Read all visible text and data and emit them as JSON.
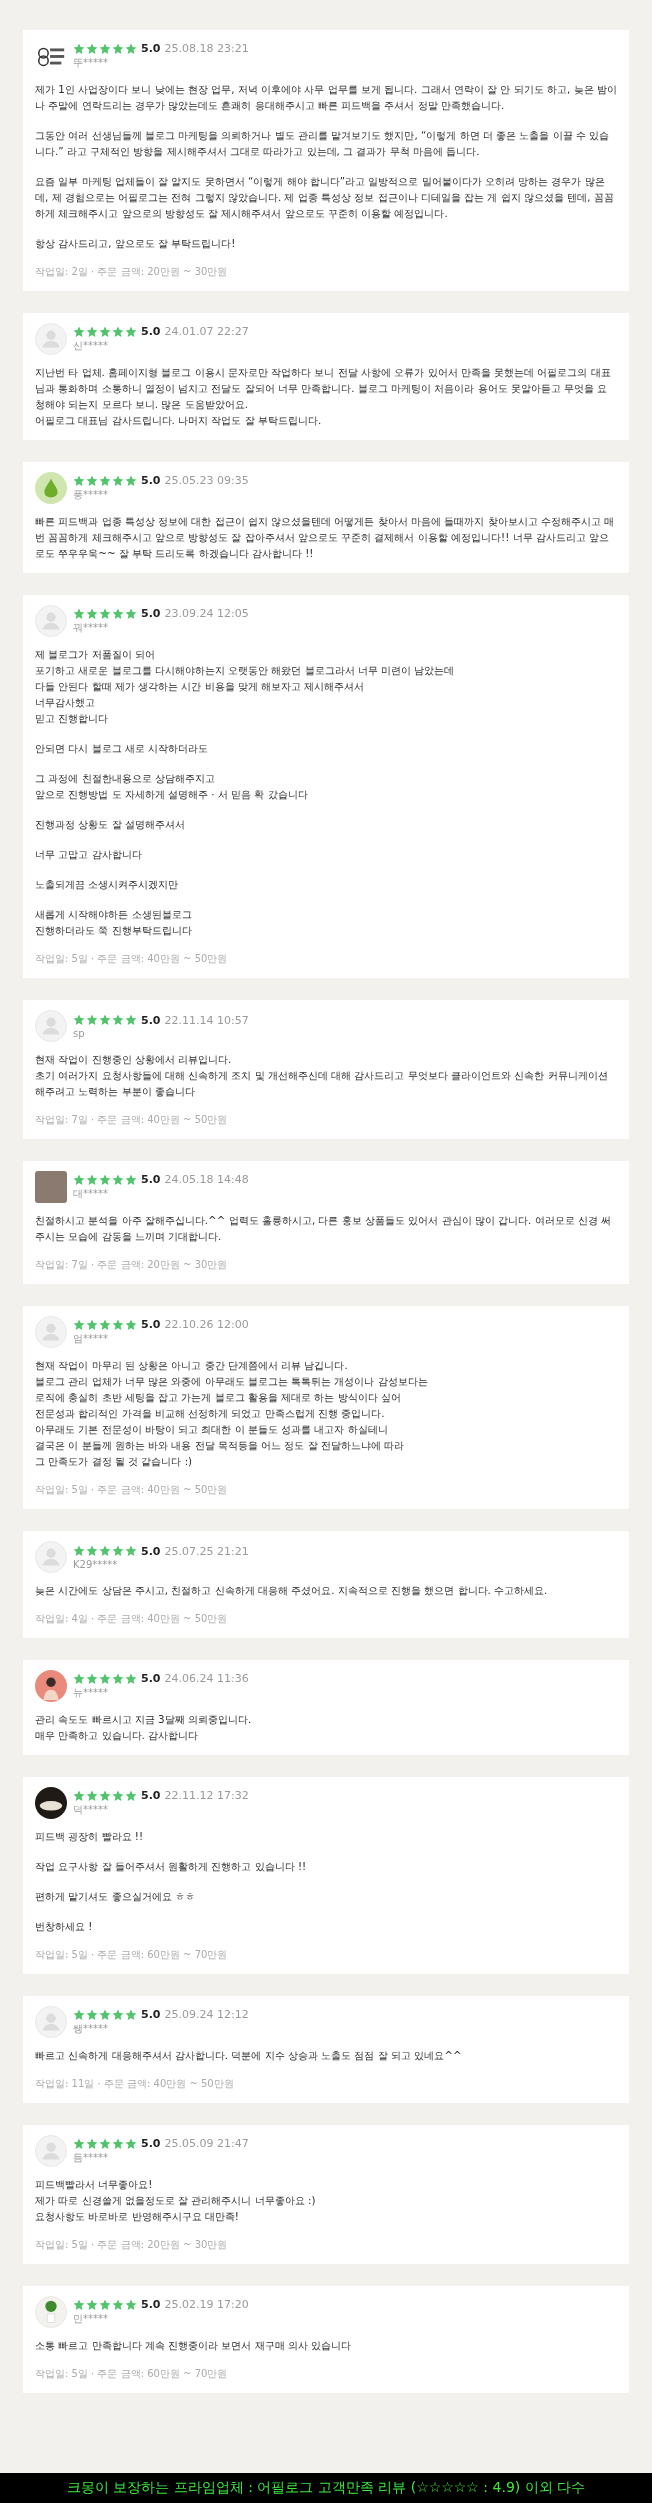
{
  "reviews": [
    {
      "avatar": {
        "kind": "logo"
      },
      "stars": 5,
      "rating": "5.0",
      "date": "25.08.18 23:21",
      "user": "뚜*****",
      "paragraphs": [
        "제가 1인 사업장이다 보니 낮에는 현장 업무, 저녁 이후에야 사무 업무를 보게 됩니다. 그래서 연락이 잘 안 되기도 하고, 늦은 밤이나 주말에 연락드리는 경우가 많았는데도 흔쾌히 응대해주시고 빠른 피드백을 주셔서 정말 만족했습니다.",
        "그동안 여러 선생님들께 블로그 마케팅을 의뢰하거나 별도 관리를 맡겨보기도 했지만, “이렇게 하면 더 좋은 노출을 이끌 수 있습니다.” 라고 구체적인 방향을 제시해주셔서 그대로 따라가고 있는데, 그 결과가 무척 마음에 듭니다.",
        "요즘 일부 마케팅 업체들이 잘 알지도 못하면서 “이렇게 해야 합니다”라고 일방적으로 밀어붙이다가 오히려 망하는 경우가 많은데, 제 경험으로는 어필로그는 전혀 그렇지 않았습니다. 제 업종 특성상 정보 접근이나 디테일을 잡는 게 쉽지 않으셨을 텐데, 꼼꼼하게 체크해주시고 앞으로의 방향성도 잘 제시해주셔서 앞으로도 꾸준히 이용할 예정입니다.",
        "항상 감사드리고, 앞으로도 잘 부탁드립니다!"
      ],
      "meta": "작업일: 2일 · 주문 금액: 20만원 ~ 30만원"
    },
    {
      "avatar": {
        "kind": "default"
      },
      "stars": 5,
      "rating": "5.0",
      "date": "24.01.07 22:27",
      "user": "신*****",
      "paragraphs": [
        "지난번 타 업체. 홈페이지형 블로그 이용시 문자로만 작업하다 보니 전달 사항에 오류가 있어서 만족을 못했는데 어필로그의  대표님과 통화하며 소통하니 열정이 넘치고 전달도 잘되어 너무 만족합니다. 블로그 마케팅이 처음이라 용어도 못알아듣고 무엇을 요청해야 되는지 모르다 보니. 많은 도움받았어요.\n어필로그 대표님 감사드립니다. 나머지 작업도 잘 부탁드립니다."
      ]
    },
    {
      "avatar": {
        "kind": "pear"
      },
      "stars": 5,
      "rating": "5.0",
      "date": "25.05.23 09:35",
      "user": "풍*****",
      "paragraphs": [
        "빠른 피드백과 업종 특성상 정보에 대한 접근이 쉽지 않으셨을텐데 어떻게든 찾아서 마음에 들때까지 찾아보시고 수정해주시고 매번 꼼꼼하게 체크해주시고 앞으로 방향성도 잘 잡아주셔서 앞으로도 꾸준히 결제해서 이용할 예정입니다!! 너무 감사드리고 앞으로도 쭈우우욱~~ 잘 부탁 드리도록 하겠습니다 감사합니다 !!"
      ]
    },
    {
      "avatar": {
        "kind": "default"
      },
      "stars": 5,
      "rating": "5.0",
      "date": "23.09.24 12:05",
      "user": "꿔*****",
      "paragraphs": [
        "제 블로그가 저품질이 되어\n포기하고 새로운 블로그를 다시해야하는지  오랫동안 해왔던 블로그라서 너무 미련이 남았는데\n다들 안된다 할때  제가 생각하는 시간 비용을  맞게  해보자고 제시해주셔서\n너무감사했고\n믿고  진행합니다",
        "안되면  다시 블로그 새로 시작하더라도",
        "그 과정에 친절한내용으로 상담해주지고\n앞으로 진행방법 도 자세하게 설명해주 · 서 믿음 확 갔습니다",
        "진행과정 상황도 잘 설명해주셔서",
        "너무 고맙고 감사합니다",
        "노출되게끔 소생시켜주시겠지만",
        "새롭게 시작해야하든  소생된블로그\n진행하더라도  쭉 진행부탁드립니다"
      ],
      "meta": "작업일: 5일 · 주문 금액: 40만원 ~ 50만원"
    },
    {
      "avatar": {
        "kind": "default"
      },
      "stars": 5,
      "rating": "5.0",
      "date": "22.11.14 10:57",
      "user": "sp",
      "paragraphs": [
        "현재 작업이 진행중인 상황에서  리뷰입니다.\n초기 여러가지 요청사항들에 대해 신속하게 조치 및 개선해주신데 대해 감사드리고 무엇보다 클라이언트와 신속한 커뮤니케이션 해주려고 노력하는 부분이 좋습니다"
      ],
      "meta": "작업일: 7일 · 주문 금액: 40만원 ~ 50만원"
    },
    {
      "avatar": {
        "kind": "photo"
      },
      "stars": 5,
      "rating": "5.0",
      "date": "24.05.18 14:48",
      "user": "대*****",
      "paragraphs": [
        "친절하시고 분석을 아주 잘해주십니다.^^ 업력도 훌륭하시고, 다른 홍보 상품들도 있어서 관심이 많이 갑니다. 여러모로 신경 써주시는 모습에 감동을 느끼며 기대합니다."
      ],
      "meta": "작업일: 7일 · 주문 금액: 20만원 ~ 30만원"
    },
    {
      "avatar": {
        "kind": "default"
      },
      "stars": 5,
      "rating": "5.0",
      "date": "22.10.26 12:00",
      "user": "엄*****",
      "paragraphs": [
        "현재 작업이 마무리 된 상황은 아니고 중간 단계쯤에서 리뷰 남깁니다.\n블로그 관리 업체가 너무 많은 와중에 아무래도 블로그는 톡톡튀는 개성이나 감성보다는\n로직에 충실히 초반 세팅을 잡고 가는게 블로그 활용을 제대로 하는 방식이다 싶어\n전문성과 합리적인 가격을 비교해 선정하게 되었고 만족스럽게 진행 중입니다.\n아무래도 기본 전문성이 바탕이 되고 최대한 이 분들도 성과를 내고자 하실테니\n결국은 이 분들께 원하는 바와 내용 전달 목적등을 어느 정도 잘 전달하느냐에 따라\n그 만족도가 결정 될 것 같습니다 :)"
      ],
      "meta": "작업일: 5일 · 주문 금액: 40만원 ~ 50만원"
    },
    {
      "avatar": {
        "kind": "default"
      },
      "stars": 5,
      "rating": "5.0",
      "date": "25.07.25 21:21",
      "user": "K29*****",
      "paragraphs": [
        "늦은 시간에도 상담은 주시고, 친절하고 신속하게 대응해 주셨어요. 지속적으로 진행을 했으면 합니다. 수고하세요."
      ],
      "meta": "작업일: 4일 · 주문 금액: 40만원 ~ 50만원"
    },
    {
      "avatar": {
        "kind": "portrait"
      },
      "stars": 5,
      "rating": "5.0",
      "date": "24.06.24 11:36",
      "user": "뉴*****",
      "paragraphs": [
        "관리 속도도 빠르시고 지금 3달째 의뢰중입니다.\n매우 만족하고 있습니다. 감사합니다"
      ]
    },
    {
      "avatar": {
        "kind": "dark"
      },
      "stars": 5,
      "rating": "5.0",
      "date": "22.11.12 17:32",
      "user": "덕*****",
      "paragraphs": [
        "피드백 굉장히 빨라요 !!",
        "작업 요구사항 잘 들어주셔서 원활하게 진행하고 있습니다 !!",
        "편하게 맡기셔도 좋으실거에요 ㅎㅎ",
        "번창하세요 !"
      ],
      "meta": "작업일: 5일 · 주문 금액: 60만원 ~ 70만원"
    },
    {
      "avatar": {
        "kind": "default"
      },
      "stars": 5,
      "rating": "5.0",
      "date": "25.09.24 12:12",
      "user": "쌩*****",
      "paragraphs": [
        "빠르고 신속하게 대응해주셔서 감사합니다.  덕분에 지수 상승과 노출도 점점 잘 되고 있네요^^"
      ],
      "meta": "작업일: 11일 · 주문 금액: 40만원 ~ 50만원"
    },
    {
      "avatar": {
        "kind": "default"
      },
      "stars": 5,
      "rating": "5.0",
      "date": "25.05.09 21:47",
      "user": "듬*****",
      "paragraphs": [
        "피드백빨라서 너무좋아요!\n제가 따로 신경쓸게 없을정도로 잘 관리해주시니 너무좋아요 :)\n요청사항도 바로바로 반영해주시구요 대만족!"
      ],
      "meta": "작업일: 5일 · 주문 금액: 20만원 ~ 30만원"
    },
    {
      "avatar": {
        "kind": "plant"
      },
      "stars": 5,
      "rating": "5.0",
      "date": "25.02.19 17:20",
      "user": "민*****",
      "paragraphs": [
        "소통 빠르고 만족합니다 계속 진행중이라 보면서 재구매 의사 있습니다"
      ],
      "meta": "작업일: 5일 · 주문 금액: 60만원 ~ 70만원"
    }
  ],
  "footer": {
    "text": "크몽이 보장하는 프라임업체 : 어필로그 고객만족 리뷰 (☆☆☆☆☆ : 4.9) 이외 다수"
  }
}
